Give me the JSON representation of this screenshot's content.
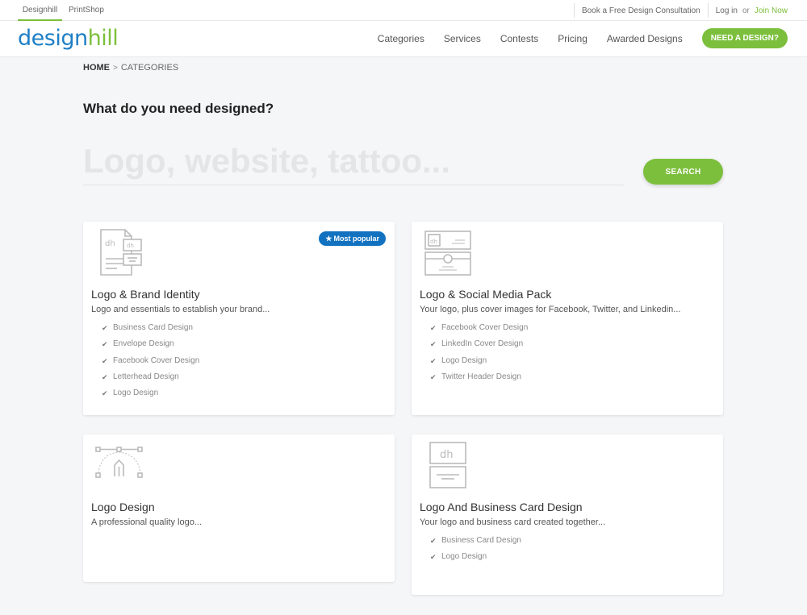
{
  "topbar": {
    "tabs": [
      {
        "label": "Designhill",
        "active": true
      },
      {
        "label": "PrintShop",
        "active": false
      }
    ],
    "consultation_link": "Book a Free Design Consultation",
    "login_link": "Log in",
    "or_text": "or",
    "join_link": "Join Now"
  },
  "header": {
    "logo_part1": "design",
    "logo_part2": "hill",
    "nav": [
      "Categories",
      "Services",
      "Contests",
      "Pricing",
      "Awarded Designs"
    ],
    "cta_label": "NEED A DESIGN?"
  },
  "breadcrumb": {
    "home": "HOME",
    "separator": ">",
    "current": "CATEGORIES"
  },
  "page_title": "What do you need designed?",
  "search": {
    "placeholder": "Logo, website, tattoo...",
    "value": "",
    "button_label": "SEARCH"
  },
  "colors": {
    "brand_green": "#7cbf3c",
    "brand_blue": "#1e7fc5",
    "badge_blue": "#1272c0"
  },
  "categories": [
    {
      "title": "Logo & Brand Identity",
      "description": "Logo and essentials to establish your brand...",
      "badge": "Most popular",
      "icon": "brand-identity-icon",
      "items": [
        "Business Card Design",
        "Envelope Design",
        "Facebook Cover Design",
        "Letterhead Design",
        "Logo Design"
      ]
    },
    {
      "title": "Logo & Social Media Pack",
      "description": "Your logo, plus cover images for Facebook, Twitter, and Linkedin...",
      "icon": "social-media-pack-icon",
      "items": [
        "Facebook Cover Design",
        "LinkedIn Cover Design",
        "Logo Design",
        "Twitter Header Design"
      ]
    },
    {
      "title": "Logo Design",
      "description": "A professional quality logo...",
      "icon": "pen-tool-icon",
      "items": []
    },
    {
      "title": "Logo And Business Card Design",
      "description": "Your logo and business card created together...",
      "icon": "business-card-icon",
      "items": [
        "Business Card Design",
        "Logo Design"
      ]
    }
  ]
}
